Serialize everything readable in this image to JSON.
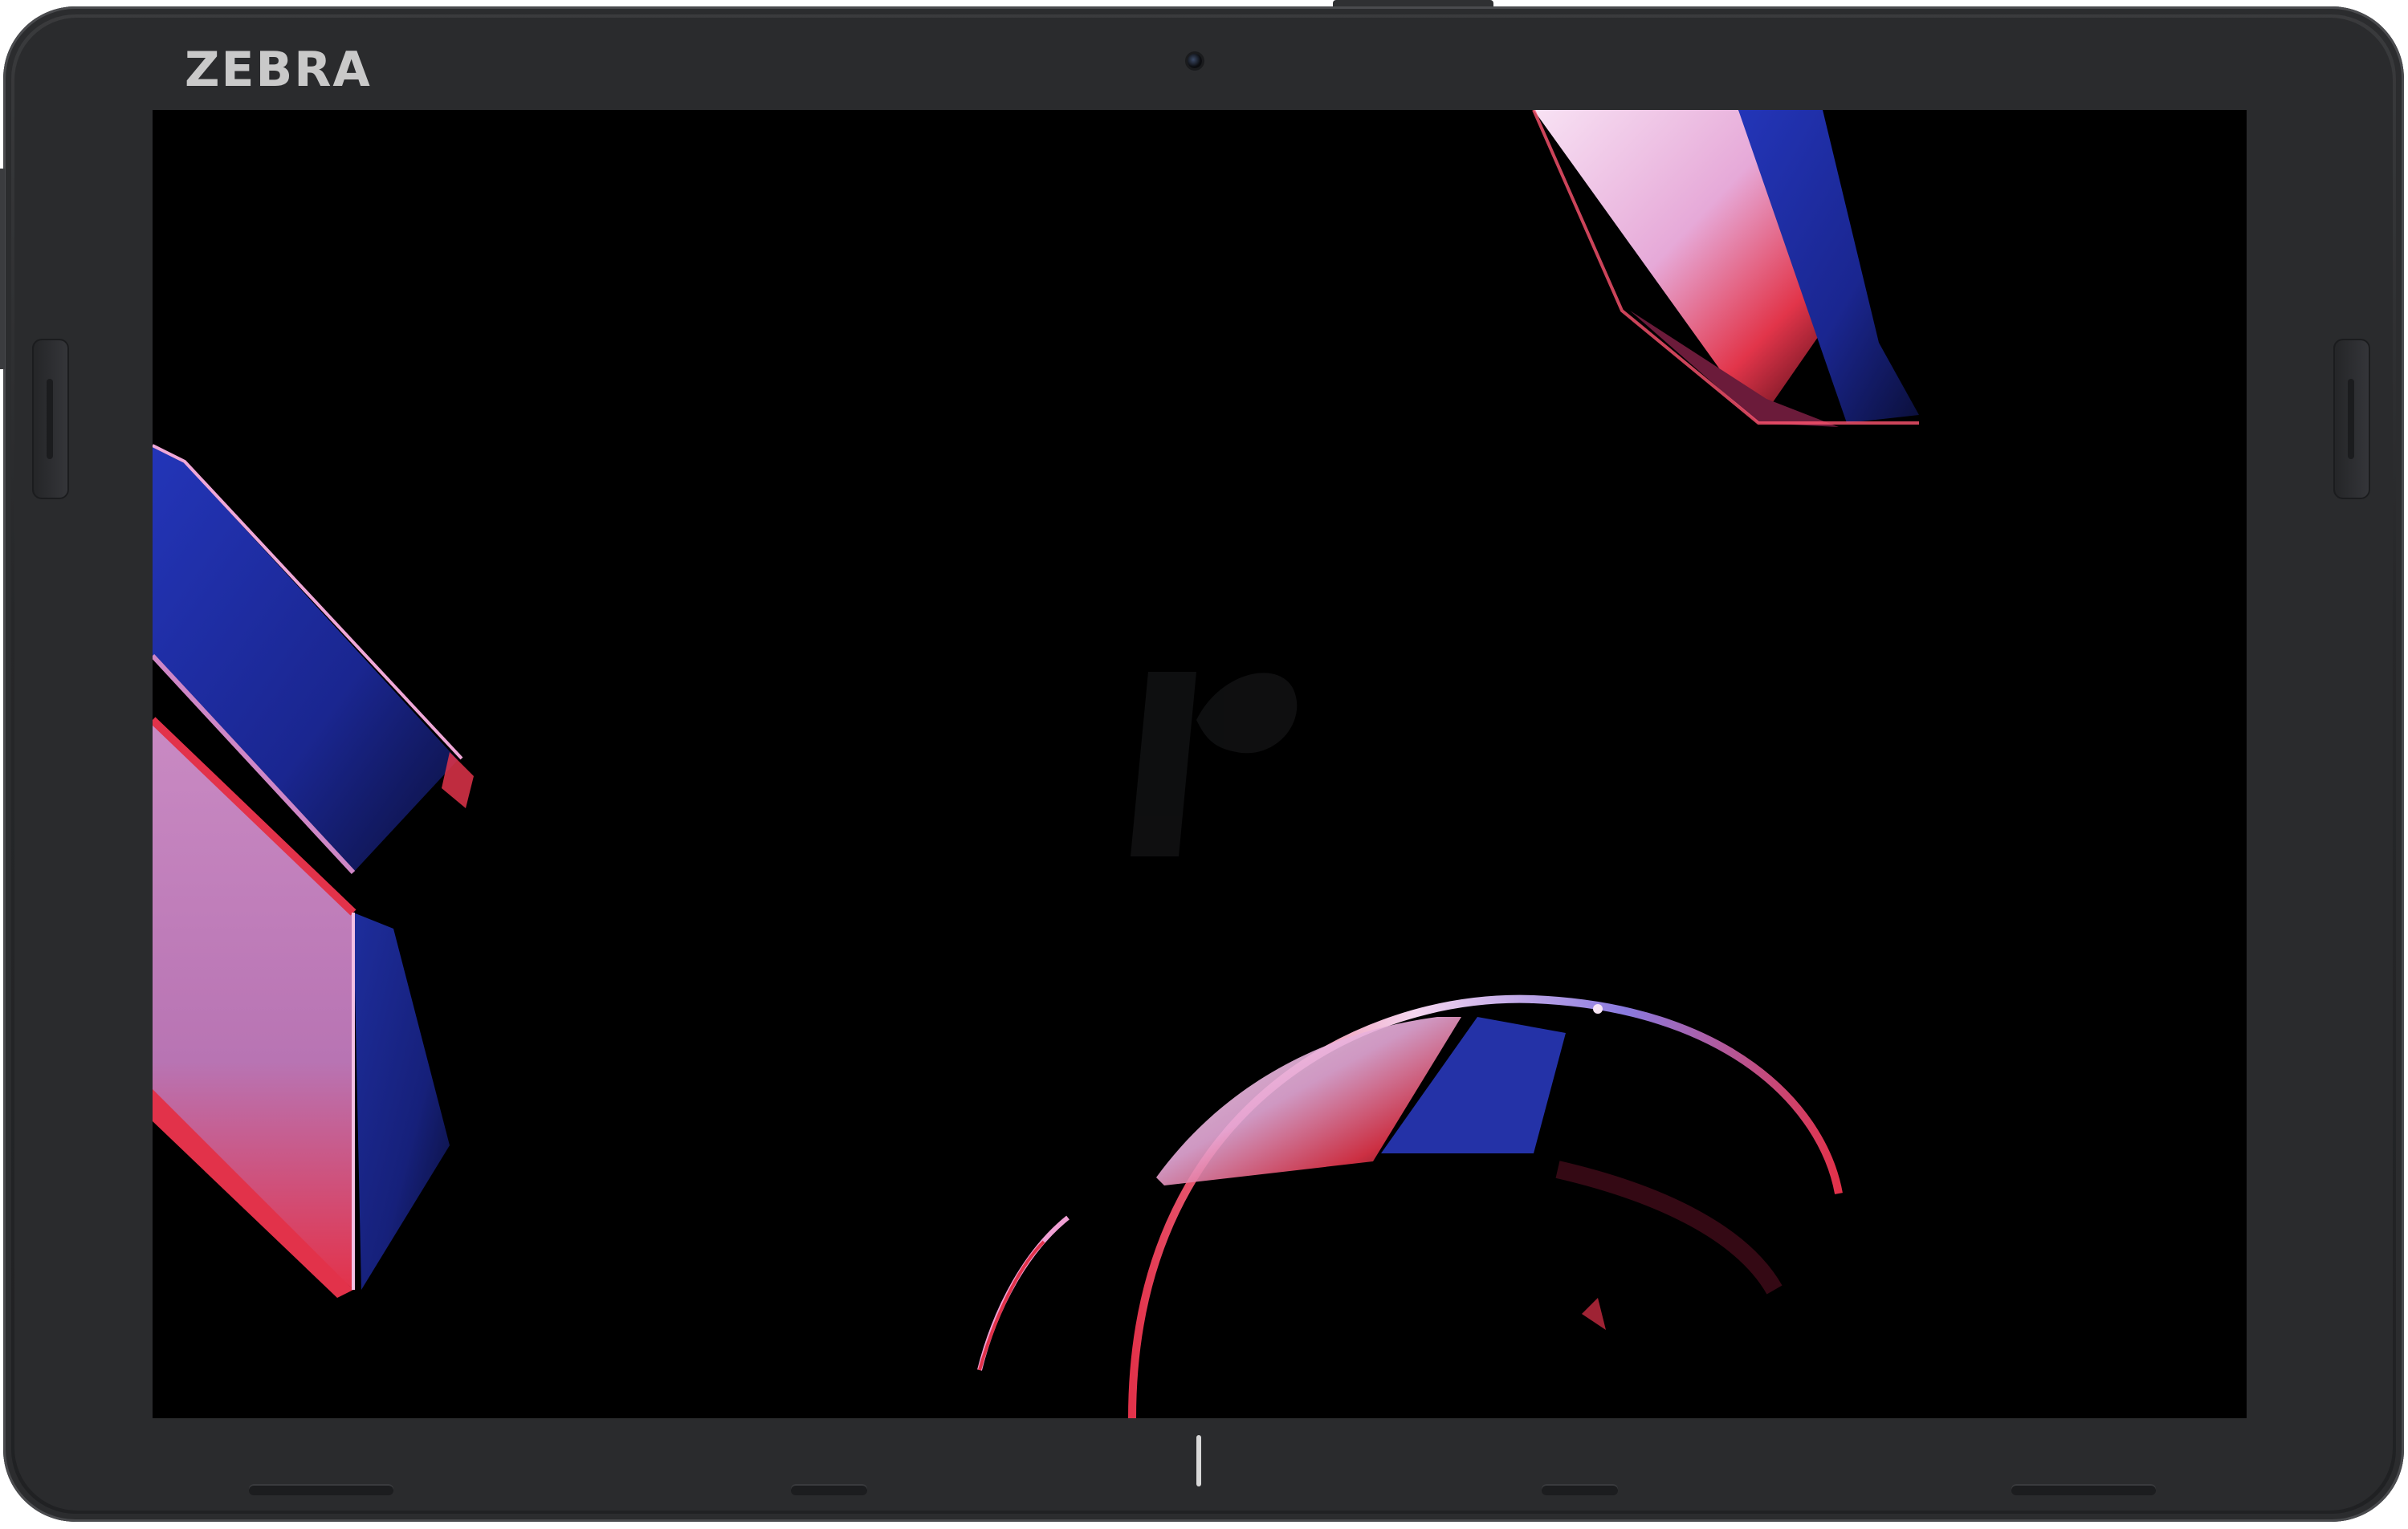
{
  "device": {
    "brand_logo_text": "ZEBRA",
    "type": "tablet",
    "bezel_color": "#262729",
    "screen_color": "#000000"
  },
  "icons": {
    "watermark": "stylized-r-watermark-icon",
    "camera": "front-camera-icon",
    "home": "home-indicator-icon"
  },
  "wallpaper": {
    "accent_colors": [
      "#1f2fa8",
      "#e2354a",
      "#d890c8",
      "#f5c8e6"
    ]
  }
}
